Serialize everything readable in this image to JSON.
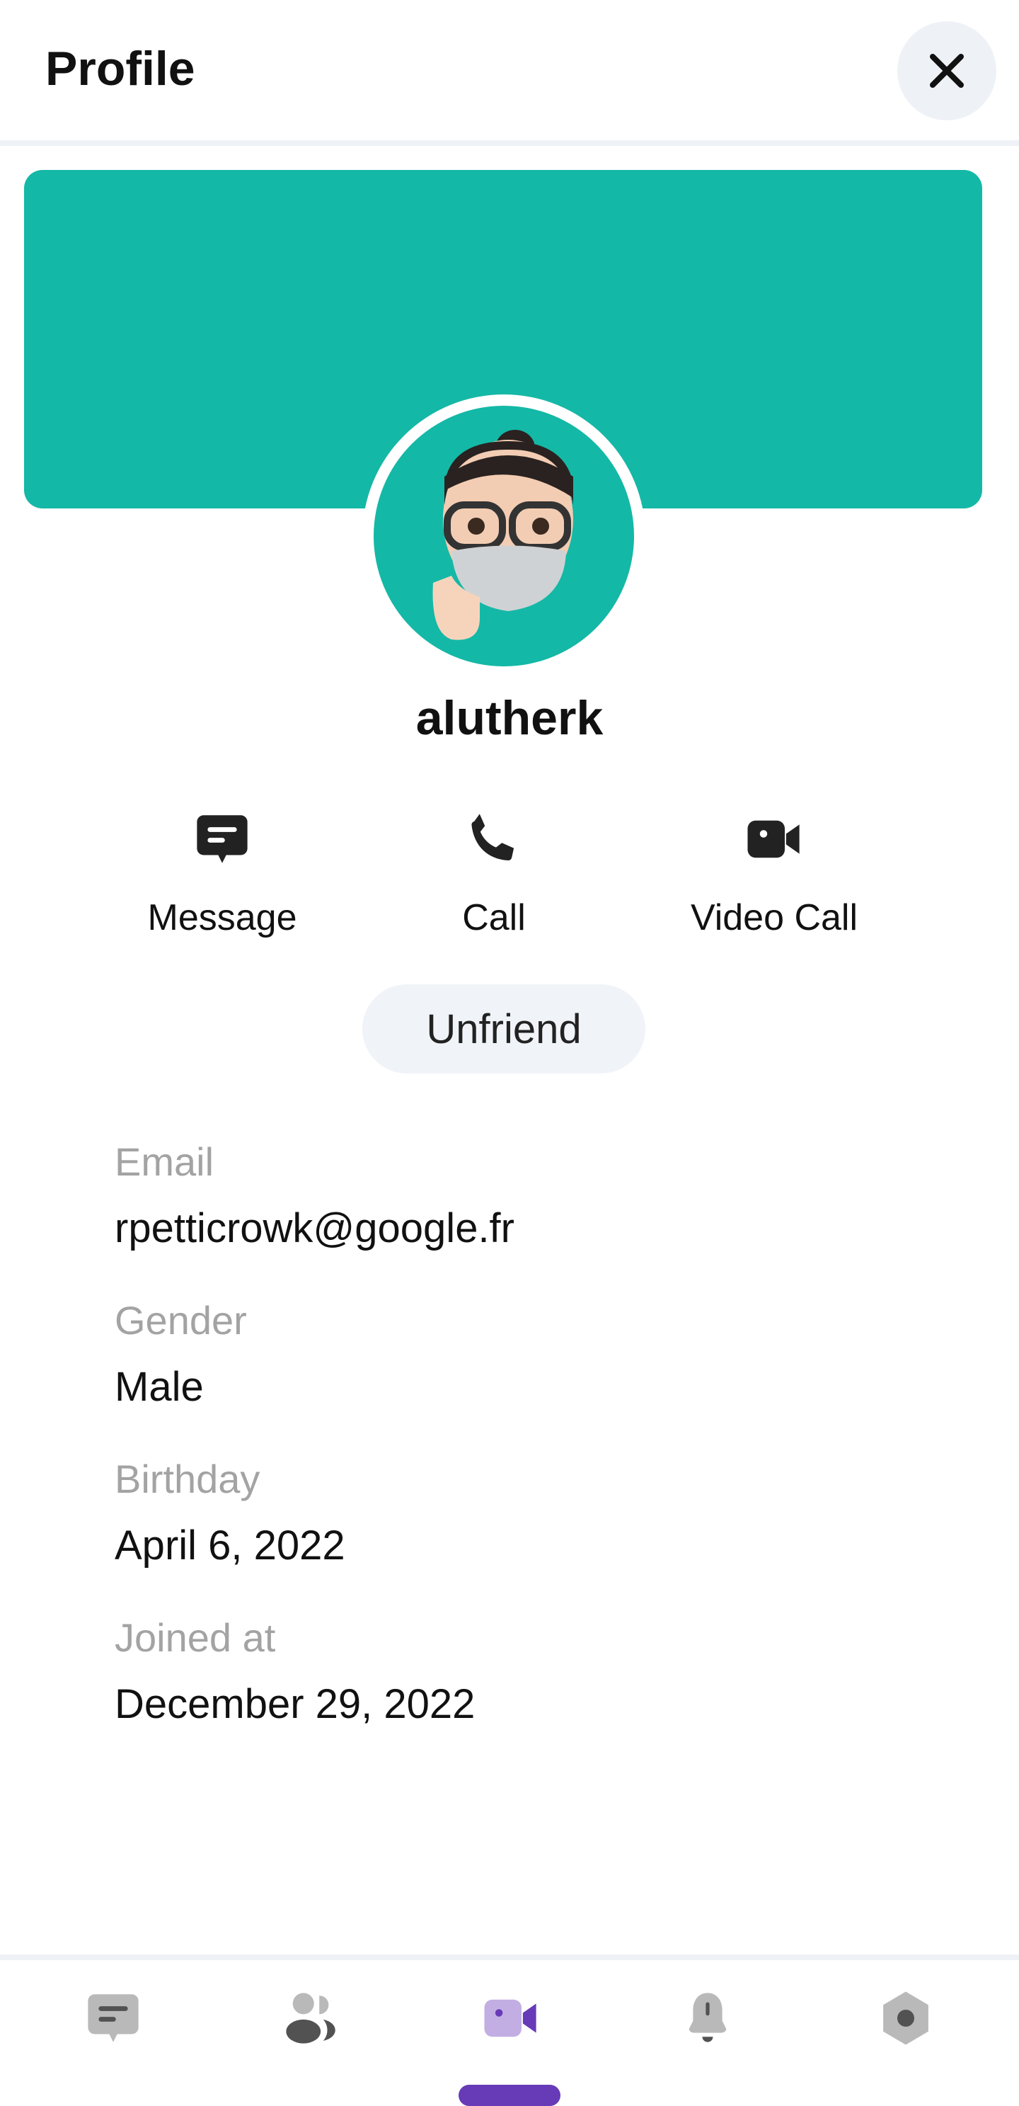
{
  "header": {
    "title": "Profile",
    "close_icon": "close-icon"
  },
  "colors": {
    "banner": "#14b8a6",
    "accent": "#673ab7",
    "accent_light": "#c3aee3",
    "icon_gray": "#b9b9b9",
    "icon_dark": "#525252"
  },
  "profile": {
    "username": "alutherk"
  },
  "actions": [
    {
      "label": "Message",
      "icon": "message-icon"
    },
    {
      "label": "Call",
      "icon": "phone-icon"
    },
    {
      "label": "Video Call",
      "icon": "video-camera-icon"
    }
  ],
  "unfriend_label": "Unfriend",
  "info": [
    {
      "label": "Email",
      "value": "rpetticrowk@google.fr"
    },
    {
      "label": "Gender",
      "value": "Male"
    },
    {
      "label": "Birthday",
      "value": "April 6, 2022"
    },
    {
      "label": "Joined at",
      "value": "December 29, 2022"
    }
  ],
  "bottom_nav": [
    {
      "icon": "chat-icon",
      "active": false
    },
    {
      "icon": "friends-icon",
      "active": false
    },
    {
      "icon": "video-call-icon",
      "active": true
    },
    {
      "icon": "bell-icon",
      "active": false
    },
    {
      "icon": "settings-icon",
      "active": false
    }
  ]
}
